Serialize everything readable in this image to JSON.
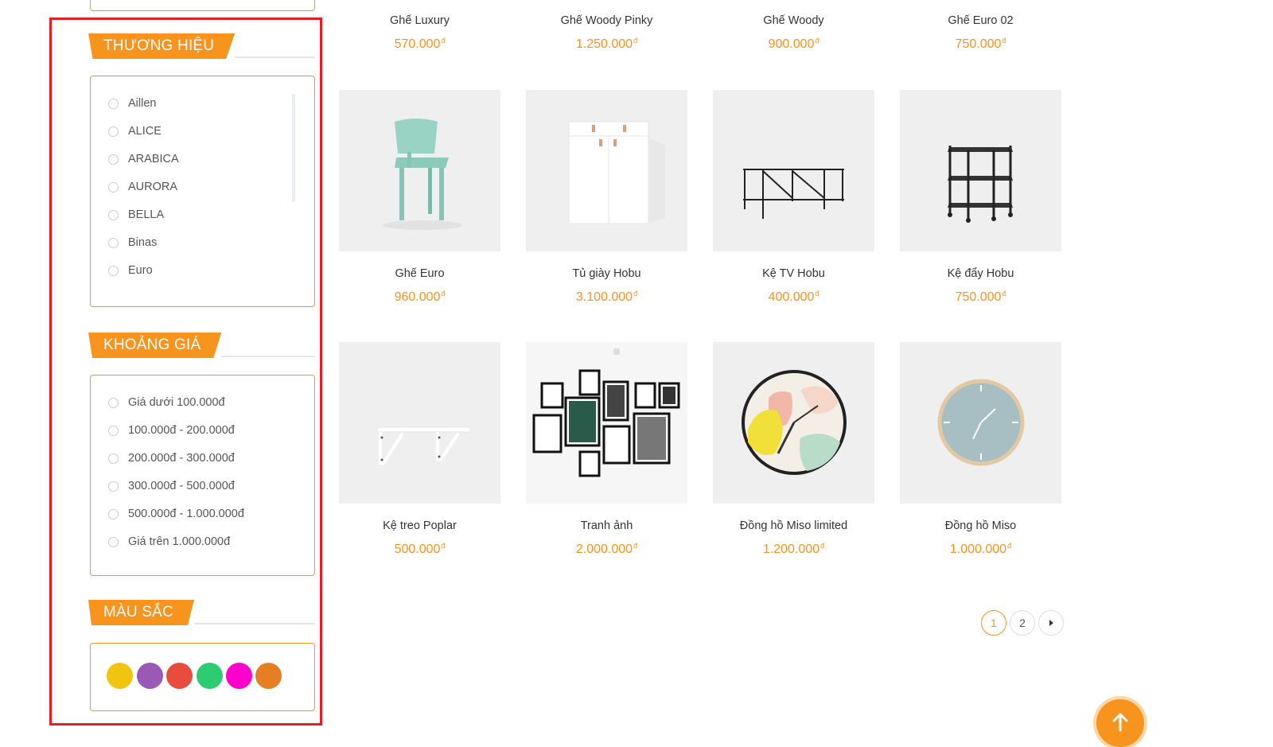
{
  "sidebar": {
    "brand": {
      "title": "THƯƠNG HIỆU",
      "options": [
        "Aillen",
        "ALICE",
        "ARABICA",
        "AURORA",
        "BELLA",
        "Binas",
        "Euro"
      ]
    },
    "price": {
      "title": "KHOẢNG GIÁ",
      "options": [
        "Giá dưới 100.000đ",
        "100.000đ - 200.000đ",
        "200.000đ - 300.000đ",
        "300.000đ - 500.000đ",
        "500.000đ - 1.000.000đ",
        "Giá trên 1.000.000đ"
      ]
    },
    "color": {
      "title": "MÀU SẮC",
      "swatches": [
        "#f1c40f",
        "#9b59b6",
        "#e74c3c",
        "#2ecc71",
        "#ff00cc",
        "#e67e22"
      ]
    }
  },
  "products": [
    {
      "name": "Ghế Luxury",
      "price": "570.000",
      "image": "none"
    },
    {
      "name": "Ghế Woody Pinky",
      "price": "1.250.000",
      "image": "none"
    },
    {
      "name": "Ghế Woody",
      "price": "900.000",
      "image": "none"
    },
    {
      "name": "Ghế Euro 02",
      "price": "750.000",
      "image": "none"
    },
    {
      "name": "Ghế Euro",
      "price": "960.000",
      "image": "mint-chair"
    },
    {
      "name": "Tủ giày Hobu",
      "price": "3.100.000",
      "image": "white-cabinet"
    },
    {
      "name": "Kệ TV Hobu",
      "price": "400.000",
      "image": "tv-stand"
    },
    {
      "name": "Kệ đẩy Hobu",
      "price": "750.000",
      "image": "rolling-shelf"
    },
    {
      "name": "Kệ treo Poplar",
      "price": "500.000",
      "image": "wall-shelf"
    },
    {
      "name": "Tranh ảnh",
      "price": "2.000.000",
      "image": "picture-frames"
    },
    {
      "name": "Đồng hồ Miso limited",
      "price": "1.200.000",
      "image": "colorful-clock"
    },
    {
      "name": "Đồng hồ Miso",
      "price": "1.000.000",
      "image": "blue-clock"
    }
  ],
  "currency_symbol": "đ",
  "pagination": {
    "pages": [
      "1",
      "2"
    ],
    "current": "1",
    "next_icon": "caret-right-icon"
  },
  "back_to_top": {
    "icon": "arrow-up-icon"
  },
  "colors": {
    "accent": "#f7941d",
    "highlight": "#e31e24",
    "image_bg": "#efefef"
  }
}
